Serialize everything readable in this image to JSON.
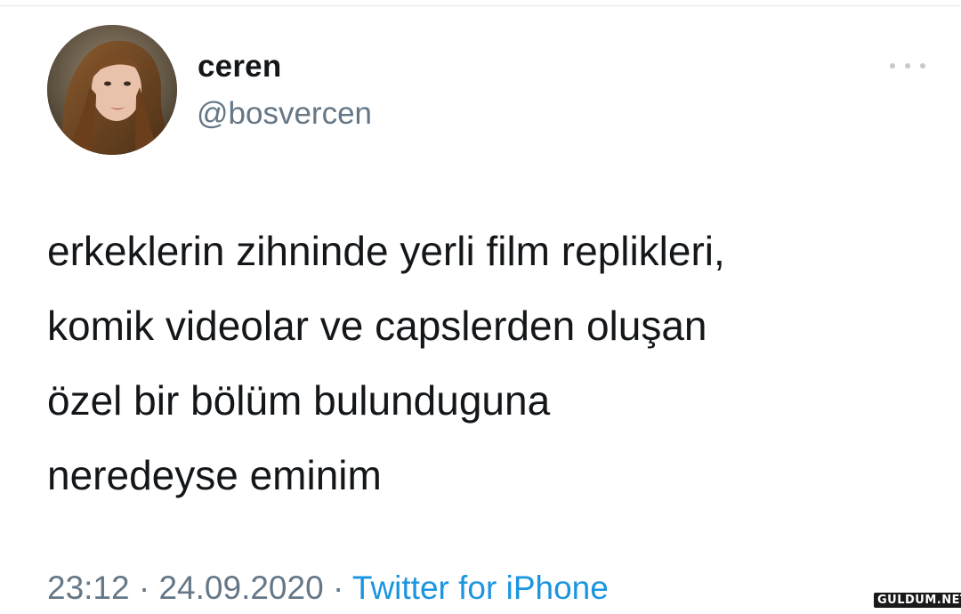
{
  "tweet": {
    "display_name": "ceren",
    "handle": "@bosvercen",
    "more_icon": "more-horizontal-icon",
    "text_lines": [
      "erkeklerin zihninde yerli film replikleri,",
      "komik videolar ve capslerden oluşan",
      "özel bir bölüm bulunduguna",
      "neredeyse eminim"
    ],
    "time": "23:12",
    "date": "24.09.2020",
    "separator": "·",
    "source": "Twitter for iPhone"
  },
  "watermark": {
    "text": "GULDUM.NET"
  },
  "colors": {
    "text_primary": "#14171a",
    "text_secondary": "#657786",
    "link": "#1b95e0"
  }
}
